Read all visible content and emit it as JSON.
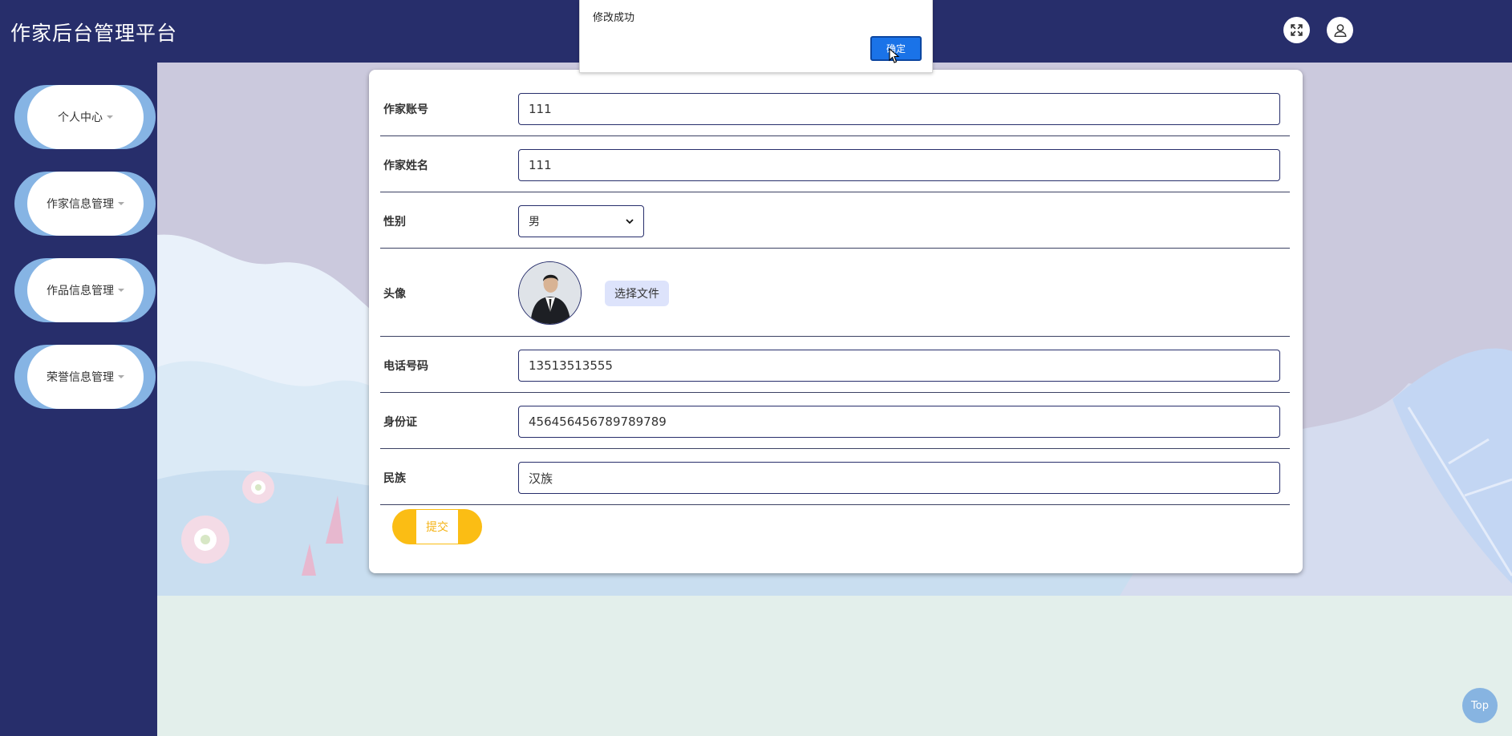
{
  "header": {
    "title": "作家后台管理平台"
  },
  "sidebar": {
    "items": [
      {
        "label": "个人中心"
      },
      {
        "label": "作家信息管理"
      },
      {
        "label": "作品信息管理"
      },
      {
        "label": "荣誉信息管理"
      }
    ]
  },
  "form": {
    "account": {
      "label": "作家账号",
      "value": "111"
    },
    "name": {
      "label": "作家姓名",
      "value": "111"
    },
    "gender": {
      "label": "性别",
      "value": "男"
    },
    "avatar": {
      "label": "头像",
      "choose_file": "选择文件"
    },
    "phone": {
      "label": "电话号码",
      "value": "13513513555"
    },
    "id_card": {
      "label": "身份证",
      "value": "456456456789789789"
    },
    "ethnicity": {
      "label": "民族",
      "value": "汉族"
    },
    "submit": "提交"
  },
  "alert": {
    "message": "修改成功",
    "ok": "确定"
  },
  "back_to_top": "Top",
  "colors": {
    "nav": "#272e6b",
    "accent_blue": "#86b4e4",
    "submit_yellow": "#fbbd14",
    "page_bottom": "#e3efeb"
  }
}
